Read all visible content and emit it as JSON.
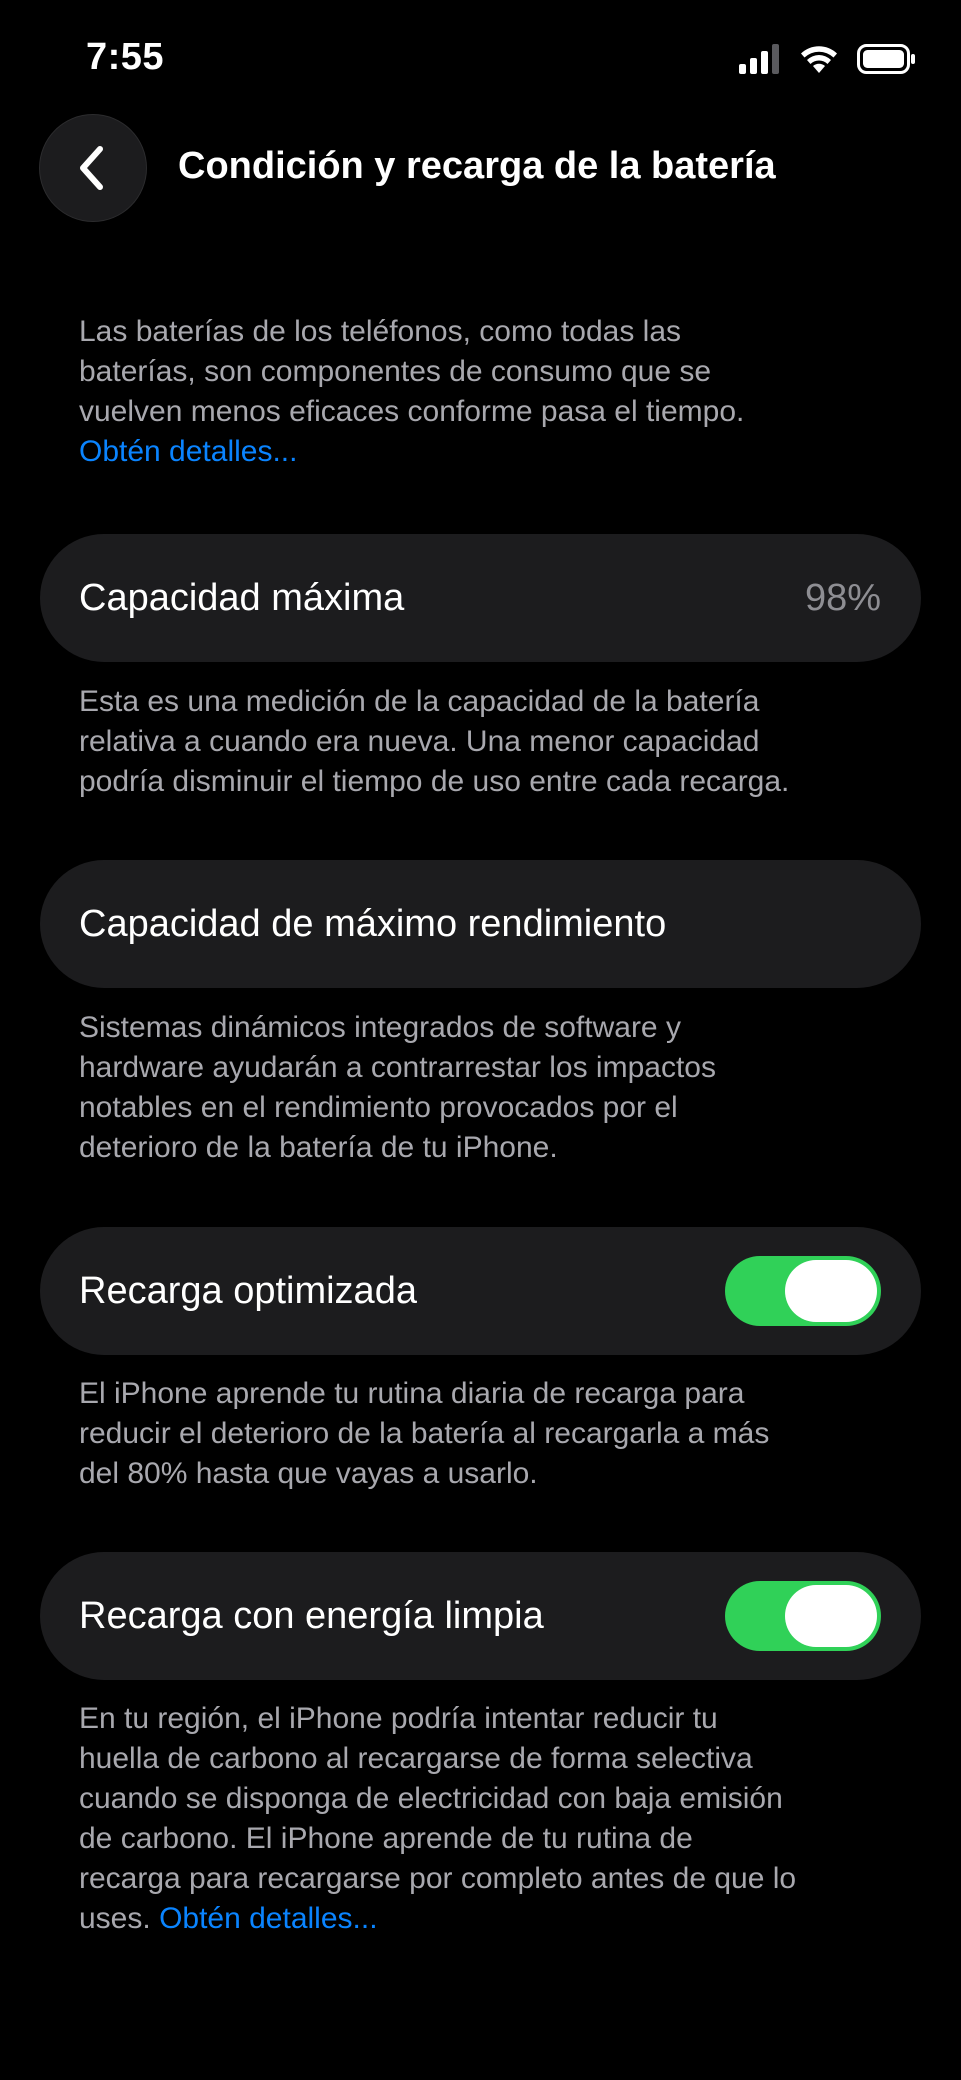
{
  "status_bar": {
    "time": "7:55",
    "icons": [
      "signal-icon",
      "wifi-icon",
      "battery-icon"
    ]
  },
  "nav": {
    "back_icon": "chevron-left-icon",
    "title": "Condición y recarga de la batería"
  },
  "intro": {
    "lines": [
      "Las baterías de los teléfonos, como todas las",
      "baterías, son componentes de consumo que se",
      "vuelven menos eficaces conforme pasa el tiempo."
    ],
    "link": "Obtén detalles..."
  },
  "max_capacity": {
    "label": "Capacidad máxima",
    "value": "98%",
    "description_lines": [
      "Esta es una medición de la capacidad de la batería",
      "relativa a cuando era nueva. Una menor capacidad",
      "podría disminuir el tiempo de uso entre cada recarga."
    ]
  },
  "peak_performance": {
    "label": "Capacidad de máximo rendimiento",
    "description_lines": [
      "Sistemas dinámicos integrados de software y",
      "hardware ayudarán a contrarrestar los impactos",
      "notables en el rendimiento provocados por el",
      "deterioro de la batería de tu iPhone."
    ]
  },
  "optimized_charging": {
    "label": "Recarga optimizada",
    "enabled": true,
    "description_lines": [
      "El iPhone aprende tu rutina diaria de recarga para",
      "reducir el deterioro de la batería al recargarla a más",
      "del 80% hasta que vayas a usarlo."
    ]
  },
  "clean_energy": {
    "label": "Recarga con energía limpia",
    "enabled": true,
    "description_lines": [
      "En tu región, el iPhone podría intentar reducir tu",
      "huella de carbono al recargarse de forma selectiva",
      "cuando se disponga de electricidad con baja emisión",
      "de carbono. El iPhone aprende de tu rutina de",
      "recarga para recargarse por completo antes de que lo"
    ],
    "last_line_prefix": "uses.",
    "link": "Obtén detalles..."
  },
  "colors": {
    "background": "#000000",
    "card": "#1c1c1e",
    "secondary_text": "#a8a8ae",
    "link": "#0a84ff",
    "toggle_on": "#30d158"
  }
}
